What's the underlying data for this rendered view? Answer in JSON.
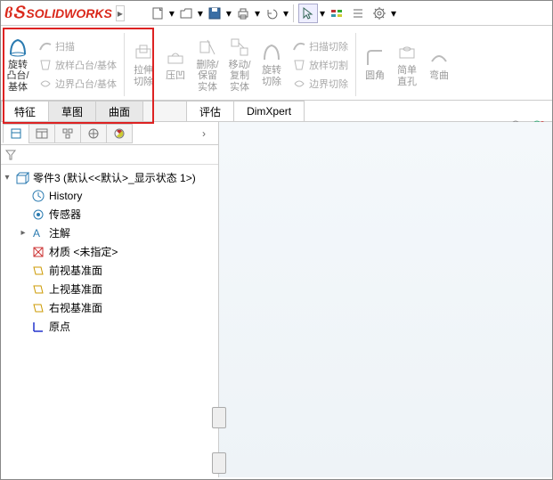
{
  "brand": "SOLIDWORKS",
  "quick": {
    "sep": "·"
  },
  "ribbon": {
    "revolve": "旋转凸台/基体",
    "sweep": "扫描",
    "loft": "放样凸台/基体",
    "boundary": "边界凸台/基体",
    "extrudeCut": "拉伸切除",
    "extrudeFill": "压凹",
    "deleteKeep": "删除/保留实体",
    "moveCopy": "移动/复制实体",
    "revolveCut": "旋转切除",
    "sweepCut": "扫描切除",
    "loftCut": "放样切割",
    "boundaryCut": "边界切除",
    "fillet": "圆角",
    "holeSimple": "简单直孔",
    "curve": "弯曲"
  },
  "tabs": {
    "feature": "特征",
    "sketch": "草图",
    "surface": "曲面",
    "evaluate": "评估",
    "dimxpert": "DimXpert"
  },
  "tree": {
    "root": "零件3  (默认<<默认>_显示状态 1>)",
    "history": "History",
    "sensors": "传感器",
    "annotations": "注解",
    "material": "材质 <未指定>",
    "front": "前视基准面",
    "top": "上视基准面",
    "right": "右视基准面",
    "origin": "原点"
  }
}
